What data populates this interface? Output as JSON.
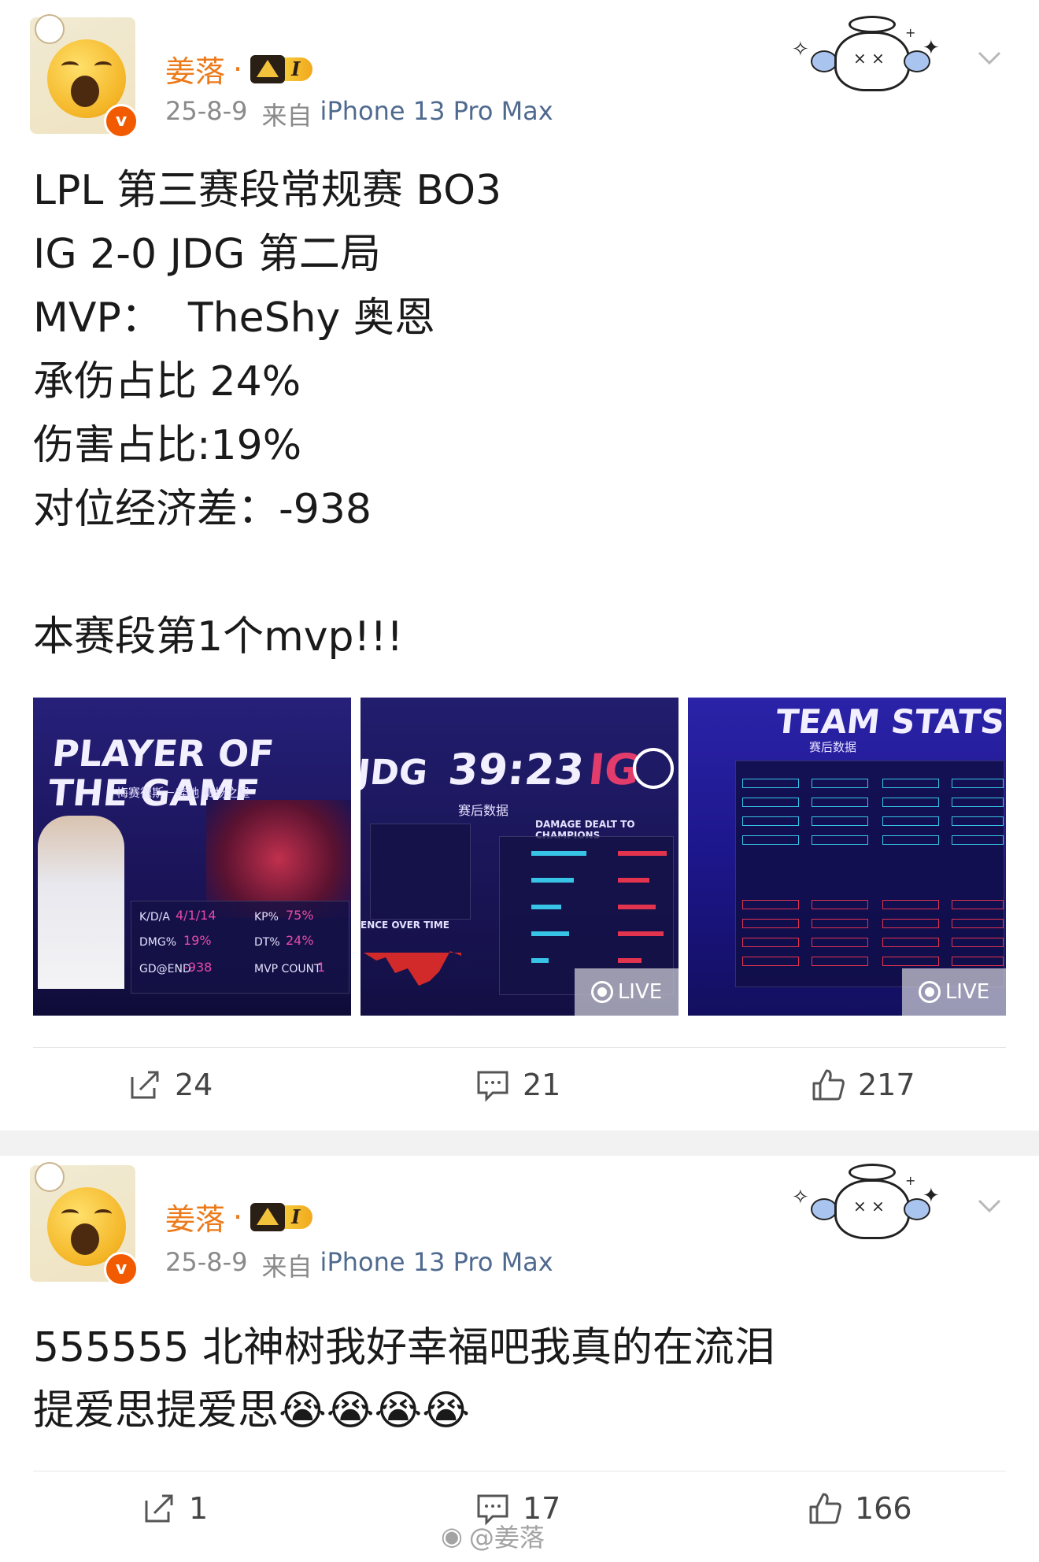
{
  "posts": [
    {
      "author": {
        "name": "姜落",
        "separator": "·",
        "vip_level": "I"
      },
      "date": "25-8-9",
      "source_prefix": "来自",
      "device": "iPhone 13 Pro Max",
      "text_lines": [
        "LPL 第三赛段常规赛 BO3",
        "IG 2-0 JDG 第二局",
        "MVP：  TheShy 奥恩",
        "承伤占比 24%",
        "伤害占比:19%",
        "对位经济差：-938",
        "",
        "本赛段第1个mvp!!!"
      ],
      "images": [
        {
          "title": "PLAYER OF THE GAME",
          "subtitle": "梅赛德斯－奔驰 赛场之星",
          "kda": "4/1/14",
          "kp": "75%",
          "dmg": "19%",
          "dt": "24%",
          "gd": "-938",
          "mvp_count": "1"
        },
        {
          "score": "39:23",
          "subtitle": "赛后数据",
          "left_team": "JDG",
          "right_team": "IG",
          "panel_title": "DAMAGE DEALT TO CHAMPIONS",
          "chart_label": "ENCE OVER TIME",
          "live": "LIVE"
        },
        {
          "title": "TEAM STATS",
          "subtitle": "赛后数据",
          "live": "LIVE"
        }
      ],
      "actions": {
        "share": "24",
        "comments": "21",
        "likes": "217"
      }
    },
    {
      "author": {
        "name": "姜落",
        "separator": "·",
        "vip_level": "I"
      },
      "date": "25-8-9",
      "source_prefix": "来自",
      "device": "iPhone 13 Pro Max",
      "text_lines": [
        "555555 北神树我好幸福吧我真的在流泪",
        "提爱思提爱思😭😭😭😭"
      ],
      "actions": {
        "share": "1",
        "comments": "17",
        "likes": "166"
      }
    }
  ],
  "watermark": "@姜落",
  "colors": {
    "username": "#ec7a1a",
    "device": "#4f6a8f",
    "meta": "#8a8a8a",
    "verified": "#f25a00"
  }
}
